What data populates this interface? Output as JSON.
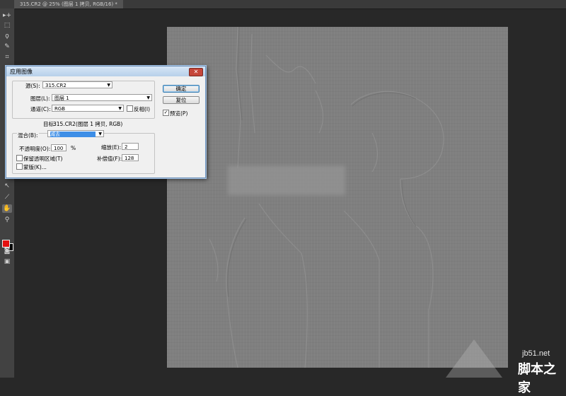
{
  "document_tab": {
    "title": "315.CR2 @ 25% (图层 1 拷贝, RGB/16) *"
  },
  "tools": [
    {
      "name": "move-tool-icon",
      "glyph": "▸+"
    },
    {
      "name": "marquee-tool-icon",
      "glyph": "⬚"
    },
    {
      "name": "lasso-tool-icon",
      "glyph": "ϙ"
    },
    {
      "name": "quick-select-tool-icon",
      "glyph": "✎"
    },
    {
      "name": "crop-tool-icon",
      "glyph": "⌗"
    },
    {
      "name": "path-select-tool-icon",
      "glyph": "↖"
    },
    {
      "name": "line-tool-icon",
      "glyph": "⟋"
    },
    {
      "name": "hand-tool-icon",
      "glyph": "✋"
    },
    {
      "name": "zoom-tool-icon",
      "glyph": "⚲"
    },
    {
      "name": "quick-mask-icon",
      "glyph": "◙"
    },
    {
      "name": "screen-mode-icon",
      "glyph": "▣"
    }
  ],
  "colors": {
    "foreground": "#e31010",
    "background": "#000000"
  },
  "dialog": {
    "title": "应用图像",
    "close_label": "✕",
    "source_label": "源(S):",
    "source_value": "315.CR2",
    "layer_label": "图层(L):",
    "layer_value": "图层 1",
    "channel_label": "通道(C):",
    "channel_value": "RGB",
    "invert_label": "反相(I)",
    "target_label": "目标:",
    "target_value": "315.CR2(图层 1 拷贝, RGB)",
    "blend_label": "混合(B):",
    "blend_value": "减去",
    "opacity_label": "不透明度(O):",
    "opacity_value": "100",
    "opacity_unit": "%",
    "scale_label": "缩放(E):",
    "scale_value": "2",
    "preserve_label": "保留透明区域(T)",
    "offset_label": "补偿值(F):",
    "offset_value": "128",
    "mask_label": "蒙版(K)...",
    "ok_label": "确定",
    "reset_label": "复位",
    "preview_label": "预览(P)",
    "preview_checked": true
  },
  "watermark": {
    "url": "jb51.net",
    "site": "脚本之家"
  }
}
